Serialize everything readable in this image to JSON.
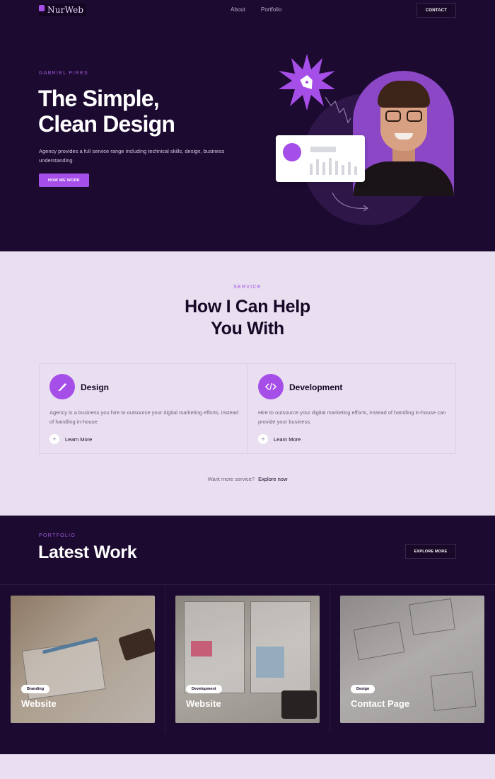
{
  "nav": {
    "logo": "NurWeb",
    "links": [
      "About",
      "Portfolio"
    ],
    "contact": "CONTACT"
  },
  "hero": {
    "eyebrow": "GABRIEL PIRES",
    "title_line1": "The Simple,",
    "title_line2": "Clean Design",
    "description": "Agency provides a full service range including technical skills, design, business understanding.",
    "button": "HOW WE WORK"
  },
  "service": {
    "eyebrow": "SERVICE",
    "title_line1": "How I Can Help",
    "title_line2": "You With",
    "items": [
      {
        "name": "Design",
        "icon": "pen-icon",
        "description": "Agency is a business you hire to outsource your digital marketing efforts, instead of handling in-house.",
        "link": "Learn More"
      },
      {
        "name": "Development",
        "icon": "code-icon",
        "description": "Hire to outsource your digital marketing efforts, instead of handling in-house can provide your business.",
        "link": "Learn More"
      }
    ],
    "footer_text": "Want more service?",
    "footer_link": "Explore now"
  },
  "portfolio": {
    "eyebrow": "PORTFOLIO",
    "title": "Latest Work",
    "button": "EXPLORE MORE",
    "items": [
      {
        "badge": "Branding",
        "name": "Website"
      },
      {
        "badge": "Development",
        "name": "Website"
      },
      {
        "badge": "Design",
        "name": "Contact Page"
      }
    ]
  },
  "colors": {
    "dark": "#1c0a30",
    "accent": "#a64ee8",
    "light": "#e9dff0"
  }
}
